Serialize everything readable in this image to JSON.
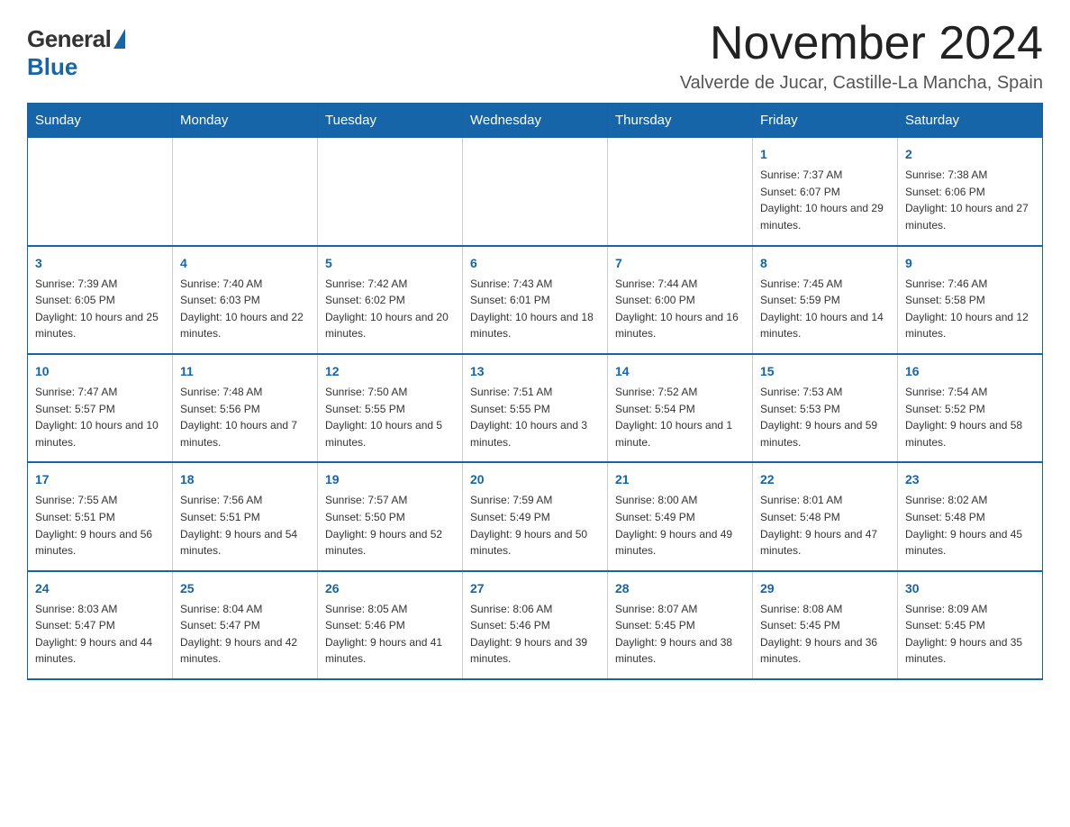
{
  "logo": {
    "general": "General",
    "blue": "Blue"
  },
  "title": "November 2024",
  "location": "Valverde de Jucar, Castille-La Mancha, Spain",
  "days_of_week": [
    "Sunday",
    "Monday",
    "Tuesday",
    "Wednesday",
    "Thursday",
    "Friday",
    "Saturday"
  ],
  "weeks": [
    [
      {
        "day": "",
        "info": ""
      },
      {
        "day": "",
        "info": ""
      },
      {
        "day": "",
        "info": ""
      },
      {
        "day": "",
        "info": ""
      },
      {
        "day": "",
        "info": ""
      },
      {
        "day": "1",
        "info": "Sunrise: 7:37 AM\nSunset: 6:07 PM\nDaylight: 10 hours and 29 minutes."
      },
      {
        "day": "2",
        "info": "Sunrise: 7:38 AM\nSunset: 6:06 PM\nDaylight: 10 hours and 27 minutes."
      }
    ],
    [
      {
        "day": "3",
        "info": "Sunrise: 7:39 AM\nSunset: 6:05 PM\nDaylight: 10 hours and 25 minutes."
      },
      {
        "day": "4",
        "info": "Sunrise: 7:40 AM\nSunset: 6:03 PM\nDaylight: 10 hours and 22 minutes."
      },
      {
        "day": "5",
        "info": "Sunrise: 7:42 AM\nSunset: 6:02 PM\nDaylight: 10 hours and 20 minutes."
      },
      {
        "day": "6",
        "info": "Sunrise: 7:43 AM\nSunset: 6:01 PM\nDaylight: 10 hours and 18 minutes."
      },
      {
        "day": "7",
        "info": "Sunrise: 7:44 AM\nSunset: 6:00 PM\nDaylight: 10 hours and 16 minutes."
      },
      {
        "day": "8",
        "info": "Sunrise: 7:45 AM\nSunset: 5:59 PM\nDaylight: 10 hours and 14 minutes."
      },
      {
        "day": "9",
        "info": "Sunrise: 7:46 AM\nSunset: 5:58 PM\nDaylight: 10 hours and 12 minutes."
      }
    ],
    [
      {
        "day": "10",
        "info": "Sunrise: 7:47 AM\nSunset: 5:57 PM\nDaylight: 10 hours and 10 minutes."
      },
      {
        "day": "11",
        "info": "Sunrise: 7:48 AM\nSunset: 5:56 PM\nDaylight: 10 hours and 7 minutes."
      },
      {
        "day": "12",
        "info": "Sunrise: 7:50 AM\nSunset: 5:55 PM\nDaylight: 10 hours and 5 minutes."
      },
      {
        "day": "13",
        "info": "Sunrise: 7:51 AM\nSunset: 5:55 PM\nDaylight: 10 hours and 3 minutes."
      },
      {
        "day": "14",
        "info": "Sunrise: 7:52 AM\nSunset: 5:54 PM\nDaylight: 10 hours and 1 minute."
      },
      {
        "day": "15",
        "info": "Sunrise: 7:53 AM\nSunset: 5:53 PM\nDaylight: 9 hours and 59 minutes."
      },
      {
        "day": "16",
        "info": "Sunrise: 7:54 AM\nSunset: 5:52 PM\nDaylight: 9 hours and 58 minutes."
      }
    ],
    [
      {
        "day": "17",
        "info": "Sunrise: 7:55 AM\nSunset: 5:51 PM\nDaylight: 9 hours and 56 minutes."
      },
      {
        "day": "18",
        "info": "Sunrise: 7:56 AM\nSunset: 5:51 PM\nDaylight: 9 hours and 54 minutes."
      },
      {
        "day": "19",
        "info": "Sunrise: 7:57 AM\nSunset: 5:50 PM\nDaylight: 9 hours and 52 minutes."
      },
      {
        "day": "20",
        "info": "Sunrise: 7:59 AM\nSunset: 5:49 PM\nDaylight: 9 hours and 50 minutes."
      },
      {
        "day": "21",
        "info": "Sunrise: 8:00 AM\nSunset: 5:49 PM\nDaylight: 9 hours and 49 minutes."
      },
      {
        "day": "22",
        "info": "Sunrise: 8:01 AM\nSunset: 5:48 PM\nDaylight: 9 hours and 47 minutes."
      },
      {
        "day": "23",
        "info": "Sunrise: 8:02 AM\nSunset: 5:48 PM\nDaylight: 9 hours and 45 minutes."
      }
    ],
    [
      {
        "day": "24",
        "info": "Sunrise: 8:03 AM\nSunset: 5:47 PM\nDaylight: 9 hours and 44 minutes."
      },
      {
        "day": "25",
        "info": "Sunrise: 8:04 AM\nSunset: 5:47 PM\nDaylight: 9 hours and 42 minutes."
      },
      {
        "day": "26",
        "info": "Sunrise: 8:05 AM\nSunset: 5:46 PM\nDaylight: 9 hours and 41 minutes."
      },
      {
        "day": "27",
        "info": "Sunrise: 8:06 AM\nSunset: 5:46 PM\nDaylight: 9 hours and 39 minutes."
      },
      {
        "day": "28",
        "info": "Sunrise: 8:07 AM\nSunset: 5:45 PM\nDaylight: 9 hours and 38 minutes."
      },
      {
        "day": "29",
        "info": "Sunrise: 8:08 AM\nSunset: 5:45 PM\nDaylight: 9 hours and 36 minutes."
      },
      {
        "day": "30",
        "info": "Sunrise: 8:09 AM\nSunset: 5:45 PM\nDaylight: 9 hours and 35 minutes."
      }
    ]
  ]
}
